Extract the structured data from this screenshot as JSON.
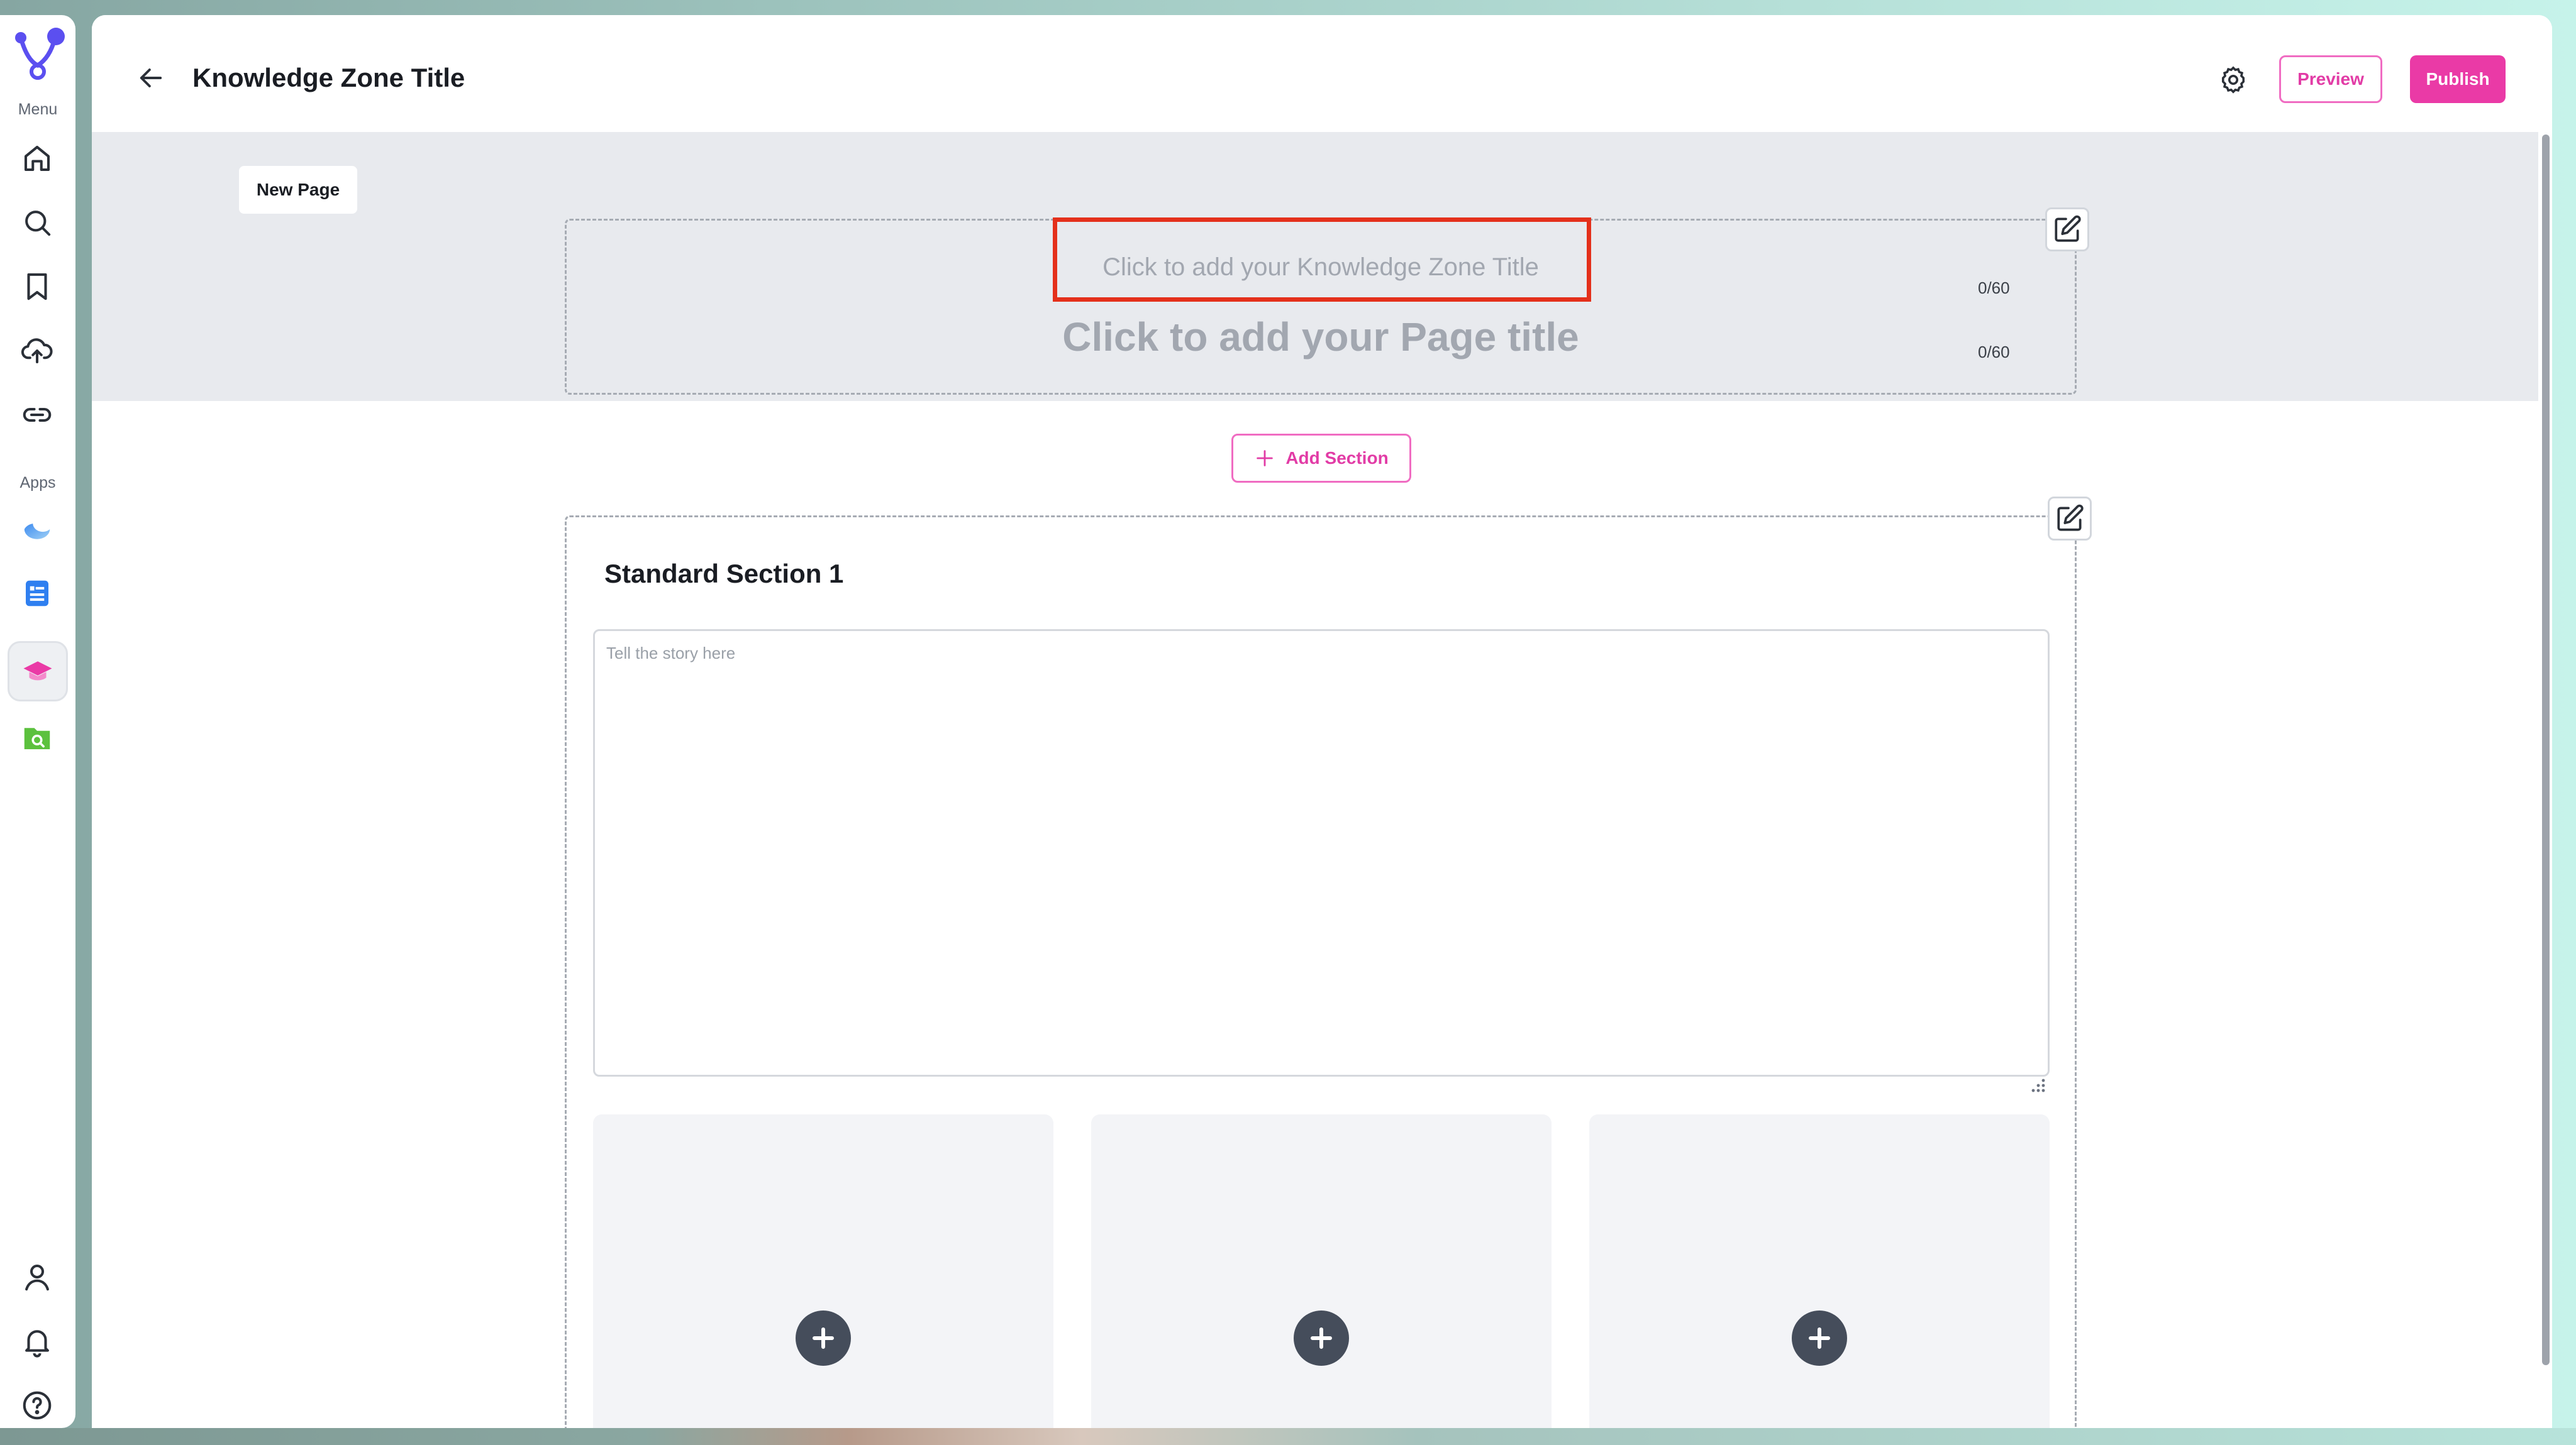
{
  "sidebar": {
    "menu_label": "Menu",
    "apps_label": "Apps",
    "menu_items": [
      "home-icon",
      "search-icon",
      "bookmark-icon",
      "upload-cloud-icon",
      "link-icon"
    ],
    "app_items": [
      "moon-app-icon",
      "notes-app-icon",
      "knowledge-zone-app-icon",
      "folder-search-app-icon"
    ],
    "bottom_items": [
      "user-icon",
      "bell-icon",
      "help-icon"
    ]
  },
  "header": {
    "title": "Knowledge Zone Title",
    "preview_label": "Preview",
    "publish_label": "Publish"
  },
  "banner": {
    "tab_label": "New Page",
    "kz_title_placeholder": "Click to add your Knowledge Zone Title",
    "kz_title_counter": "0/60",
    "page_title_placeholder": "Click to add your Page title",
    "page_title_counter": "0/60"
  },
  "content": {
    "add_section_label": "Add Section",
    "section": {
      "title": "Standard Section 1",
      "story_placeholder": "Tell the story here"
    }
  },
  "colors": {
    "accent": "#ea3aa6",
    "highlight": "#e4301b",
    "banner_bg": "#e8eaee"
  }
}
